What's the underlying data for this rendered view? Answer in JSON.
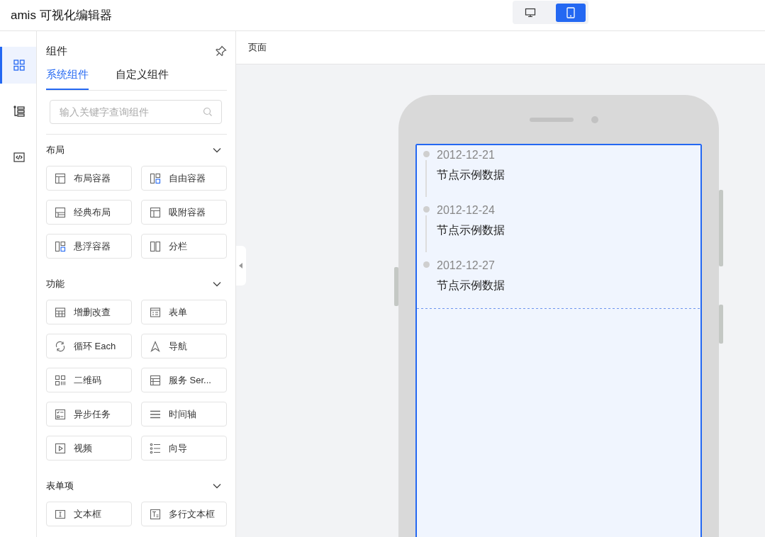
{
  "app": {
    "title": "amis 可视化编辑器"
  },
  "device_toggle": [
    {
      "selected": false
    },
    {
      "selected": true
    }
  ],
  "rail": [
    {
      "selected": true
    },
    {
      "selected": false
    },
    {
      "selected": false
    }
  ],
  "panel": {
    "title": "组件",
    "tabs": [
      {
        "label": "系统组件",
        "selected": true
      },
      {
        "label": "自定义组件",
        "selected": false
      }
    ],
    "search": {
      "placeholder": "输入关键字查询组件"
    },
    "sections": [
      {
        "title": "布局",
        "expanded": true,
        "items": [
          "布局容器",
          "自由容器",
          "经典布局",
          "吸附容器",
          "悬浮容器",
          "分栏"
        ]
      },
      {
        "title": "功能",
        "expanded": true,
        "items": [
          "增删改查",
          "表单",
          "循环 Each",
          "导航",
          "二维码",
          "服务 Ser...",
          "异步任务",
          "时间轴",
          "视频",
          "向导"
        ]
      },
      {
        "title": "表单项",
        "expanded": true,
        "items": [
          "文本框",
          "多行文本框"
        ]
      }
    ]
  },
  "breadcrumb": "页面",
  "timeline": [
    {
      "time": "2012-12-21",
      "content": "节点示例数据"
    },
    {
      "time": "2012-12-24",
      "content": "节点示例数据"
    },
    {
      "time": "2012-12-27",
      "content": "节点示例数据"
    }
  ]
}
